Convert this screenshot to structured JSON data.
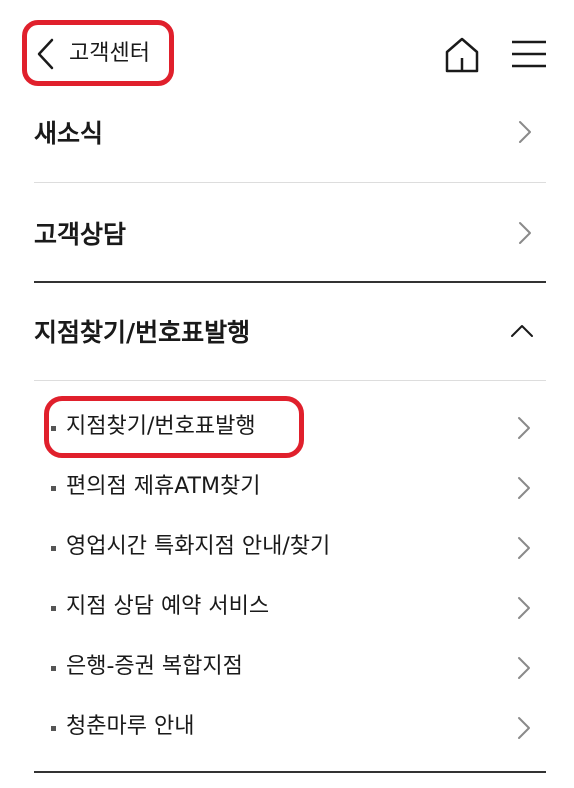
{
  "header": {
    "title": "고객센터"
  },
  "sections": [
    {
      "label": "새소식",
      "expanded": false
    },
    {
      "label": "고객상담",
      "expanded": false
    },
    {
      "label": "지점찾기/번호표발행",
      "expanded": true
    }
  ],
  "sub_items": [
    {
      "label": "지점찾기/번호표발행"
    },
    {
      "label": "편의점 제휴ATM찾기"
    },
    {
      "label": "영업시간 특화지점 안내/찾기"
    },
    {
      "label": "지점 상담 예약 서비스"
    },
    {
      "label": "은행-증권 복합지점"
    },
    {
      "label": "청춘마루 안내"
    }
  ],
  "colors": {
    "highlight": "#e0202c",
    "text": "#1a1a1a",
    "chevron": "#8a8a8a"
  },
  "icons": {
    "back": "chevron-left-icon",
    "home": "home-icon",
    "menu": "hamburger-menu-icon",
    "row": "chevron-right-icon",
    "collapse": "chevron-up-icon"
  }
}
